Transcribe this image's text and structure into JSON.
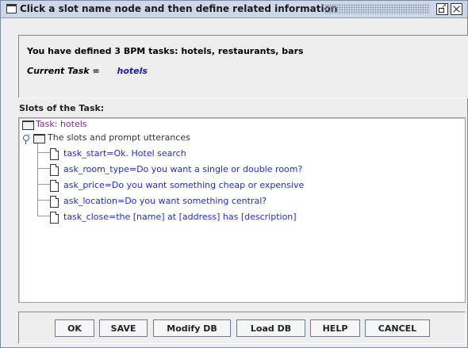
{
  "window": {
    "title": "Click a slot name node and then define related information"
  },
  "info": {
    "summary": "You have defined 3 BPM tasks: hotels, restaurants, bars",
    "current_task_label": "Current Task =",
    "current_task_value": "hotels"
  },
  "slots": {
    "heading": "Slots of the Task:",
    "root": "Task: hotels",
    "group": "The slots and prompt utterances",
    "items": [
      "task_start=Ok. Hotel search",
      "ask_room_type=Do you want a single or double room?",
      "ask_price=Do you want something cheap or expensive",
      "ask_location=Do you want something central?",
      "task_close=the [name] at [address] has [description]"
    ]
  },
  "buttons": {
    "ok": "OK",
    "save": "SAVE",
    "modify_db": "Modify DB",
    "load_db": "Load DB",
    "help": "HELP",
    "cancel": "CANCEL"
  },
  "icons": {
    "title": "window-icon",
    "restore": "restore-icon",
    "close": "close-icon",
    "folder": "folder-icon",
    "document": "document-icon",
    "expand": "expand-toggle-icon"
  },
  "colors": {
    "title_bar": "#cdd7ea",
    "task_root": "#8a22b0",
    "slot_items": "#1e2ec8",
    "current_task": "#1a1aa8"
  }
}
